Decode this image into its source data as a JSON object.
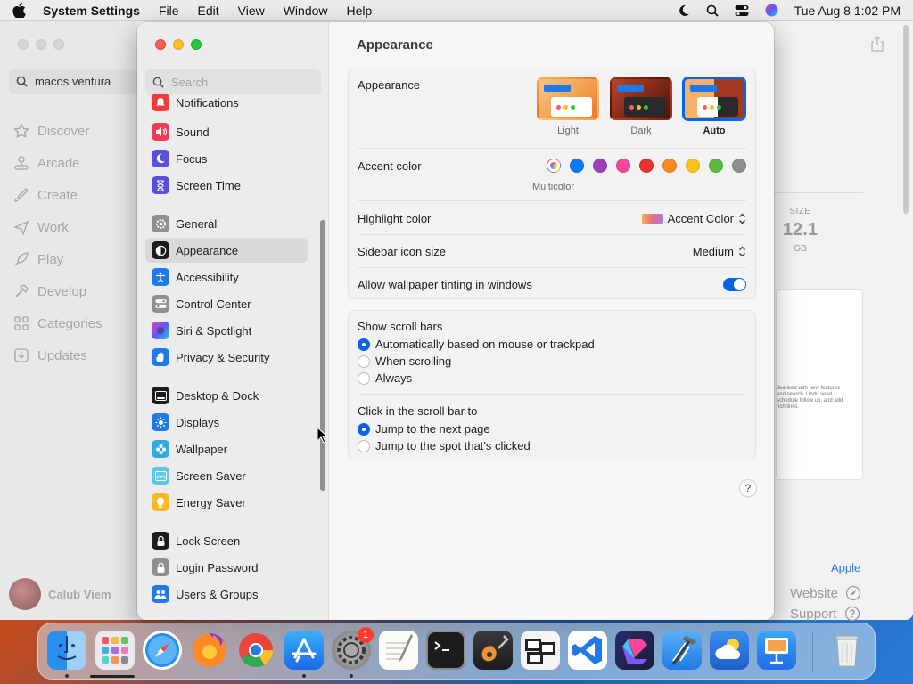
{
  "menubar": {
    "app_name": "System Settings",
    "menus": [
      "File",
      "Edit",
      "View",
      "Window",
      "Help"
    ],
    "datetime": "Tue Aug 8  1:02 PM"
  },
  "appstore": {
    "search_value": "macos ventura",
    "nav": [
      "Discover",
      "Arcade",
      "Create",
      "Work",
      "Play",
      "Develop",
      "Categories",
      "Updates"
    ],
    "user_name": "Calub Viem",
    "size_label": "SIZE",
    "size_value": "12.1",
    "size_unit": "GB",
    "preview_text": "Jeanked with new features and search. Undo send, schedule follow up, and add rich links.",
    "developer_link": "Apple",
    "website_label": "Website",
    "support_label": "Support"
  },
  "settings": {
    "search_placeholder": "Search",
    "sidebar_items": [
      "Notifications",
      "Sound",
      "Focus",
      "Screen Time",
      "General",
      "Appearance",
      "Accessibility",
      "Control Center",
      "Siri & Spotlight",
      "Privacy & Security",
      "Desktop & Dock",
      "Displays",
      "Wallpaper",
      "Screen Saver",
      "Energy Saver",
      "Lock Screen",
      "Login Password",
      "Users & Groups"
    ],
    "selected_item": "Appearance",
    "page_title": "Appearance",
    "appearance": {
      "label": "Appearance",
      "options": [
        "Light",
        "Dark",
        "Auto"
      ],
      "selected": "Auto"
    },
    "accent": {
      "label": "Accent color",
      "selected_name": "Multicolor",
      "colors": [
        "#ff6b6b",
        "#0a7bf5",
        "#9b3fb5",
        "#f7479b",
        "#e8322f",
        "#f68a1e",
        "#fcc21b",
        "#5cb83f",
        "#8e8e8e"
      ]
    },
    "highlight": {
      "label": "Highlight color",
      "value": "Accent Color"
    },
    "sidebar_icon_size": {
      "label": "Sidebar icon size",
      "value": "Medium"
    },
    "wallpaper_tinting": {
      "label": "Allow wallpaper tinting in windows",
      "enabled": true
    },
    "scroll_bars": {
      "label": "Show scroll bars",
      "options": [
        "Automatically based on mouse or trackpad",
        "When scrolling",
        "Always"
      ],
      "selected": "Automatically based on mouse or trackpad"
    },
    "click_scroll": {
      "label": "Click in the scroll bar to",
      "options": [
        "Jump to the next page",
        "Jump to the spot that's clicked"
      ],
      "selected": "Jump to the next page"
    },
    "help_label": "?"
  },
  "dock": {
    "apps": [
      "Finder",
      "Launchpad",
      "Safari",
      "Firefox",
      "Chrome",
      "App Store",
      "System Settings",
      "TextEdit",
      "Terminal",
      "GarageBand",
      "Preview",
      "VS Code",
      "Shortcuts",
      "Xcode",
      "Weather",
      "Keynote",
      "Trash"
    ],
    "system_settings_badge": "1"
  },
  "colors": {
    "accent_blue": "#0a63e6",
    "close": "#fe5f57",
    "minimize": "#febc2e",
    "maximize": "#28c840"
  }
}
